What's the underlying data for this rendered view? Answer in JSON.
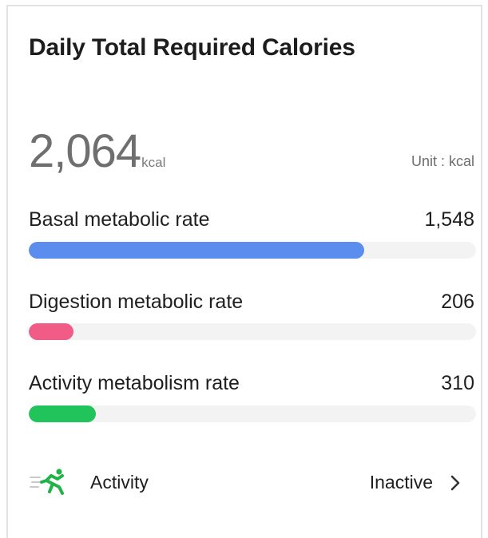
{
  "card": {
    "title": "Daily Total Required Calories",
    "total_value": "2,064",
    "total_unit": "kcal",
    "unit_label": "Unit : kcal"
  },
  "rates": [
    {
      "label": "Basal metabolic rate",
      "value": "1,548",
      "fraction": 0.75,
      "color": "#5b8def"
    },
    {
      "label": "Digestion metabolic rate",
      "value": "206",
      "fraction": 0.1,
      "color": "#f05c86"
    },
    {
      "label": "Activity metabolism rate",
      "value": "310",
      "fraction": 0.15,
      "color": "#21c45a"
    }
  ],
  "activity": {
    "icon": "running-person-icon",
    "label": "Activity",
    "value": "Inactive",
    "chevron": "chevron-right-icon",
    "icon_color": "#21b24a"
  },
  "colors": {
    "track": "#f3f3f3",
    "border": "#e2e2e2"
  }
}
